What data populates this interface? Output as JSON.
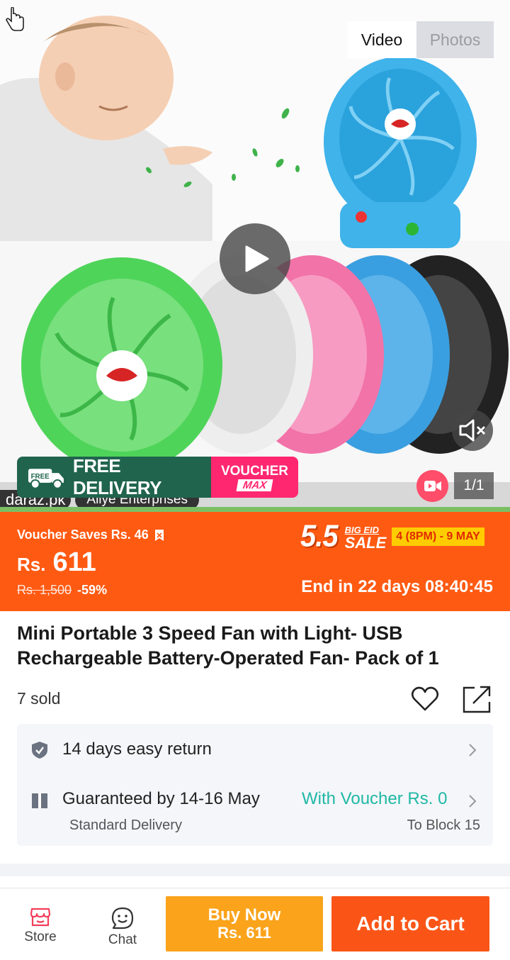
{
  "media": {
    "tab_video": "Video",
    "tab_photos": "Photos",
    "active_tab": "Video",
    "page_counter": "1/1"
  },
  "promo": {
    "free_badge": "FREE",
    "free_delivery": "FREE DELIVERY",
    "voucher": "VOUCHER",
    "voucher_max": "MAX",
    "watermark_site": "daraz.pk",
    "watermark_seller": "Allye Enterprises"
  },
  "price": {
    "voucher_saves": "Voucher Saves Rs. 46",
    "currency": "Rs.",
    "amount": "611",
    "original": "Rs. 1,500",
    "discount": "-59%",
    "sale_number": "5.5",
    "sale_big_eid": "BIG EID",
    "sale_word": "SALE",
    "sale_dates": "4 (8PM) - 9 MAY",
    "countdown": "End in 22 days 08:40:45"
  },
  "product": {
    "title": "Mini Portable 3 Speed Fan with Light- USB Rechargeable Battery-Operated Fan- Pack of 1",
    "sold": "7 sold"
  },
  "service": {
    "return": "14 days easy return",
    "guarantee": "Guaranteed by 14-16 May",
    "voucher": "With Voucher Rs. 0",
    "delivery_type": "Standard Delivery",
    "destination": "To Block 15"
  },
  "bottom_bar": {
    "store": "Store",
    "chat": "Chat",
    "buy_now_label": "Buy Now",
    "buy_now_price": "Rs. 611",
    "add_to_cart": "Add to Cart"
  },
  "colors": {
    "accent_orange": "#ff5a12",
    "buy_now": "#faa31b",
    "add_to_cart": "#fa5517",
    "voucher_teal": "#1fb8a4",
    "promo_green": "#20644e",
    "promo_pink": "#ff2770"
  }
}
